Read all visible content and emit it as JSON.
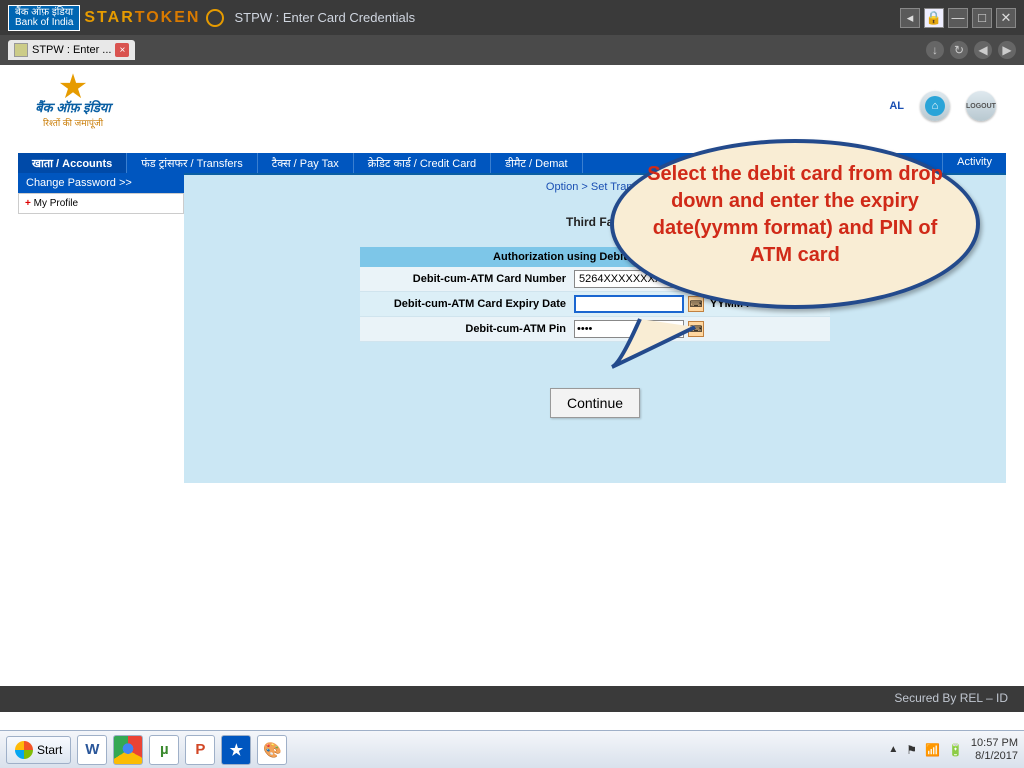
{
  "titlebar": {
    "logo_top": "बैंक ऑफ़ इंडिया",
    "logo_bottom": "Bank of India",
    "brand_star": "STAR",
    "brand_token": "TOKEN",
    "title": "STPW : Enter Card Credentials"
  },
  "tab": {
    "label": "STPW : Enter ..."
  },
  "header": {
    "bank_name": "बैंक ऑफ़ इंडिया",
    "tagline": "रिश्तों की जमापूंजी",
    "al": "AL",
    "logout": "LOGOUT"
  },
  "nav": {
    "items": [
      "खाता / Accounts",
      "फंड ट्रांसफर / Transfers",
      "टैक्स / Pay Tax",
      "क्रेडिट कार्ड / Credit Card",
      "डीमैट / Demat"
    ],
    "right": "Activity"
  },
  "sidebar": {
    "header": "Change Password >>",
    "item": "My Profile"
  },
  "breadcrumb": "Option > Set Transa",
  "section_title": "Third Fact",
  "form": {
    "header": "Authorization using Debit-cum-ATM Ca",
    "row1_label": "Debit-cum-ATM Card Number",
    "row1_value": "5264XXXXXXXX5071",
    "row2_label": "Debit-cum-ATM Card Expiry Date",
    "row2_value": "",
    "row2_hint": "YYMM Format",
    "row3_label": "Debit-cum-ATM Pin",
    "row3_value": "••••",
    "continue": "Continue"
  },
  "callout": "Select the debit card from drop down and enter the expiry date(yymm format) and PIN of ATM card",
  "footer": {
    "secured": "Secured By REL – ID"
  },
  "taskbar": {
    "start": "Start",
    "time": "10:57 PM",
    "date": "8/1/2017"
  }
}
